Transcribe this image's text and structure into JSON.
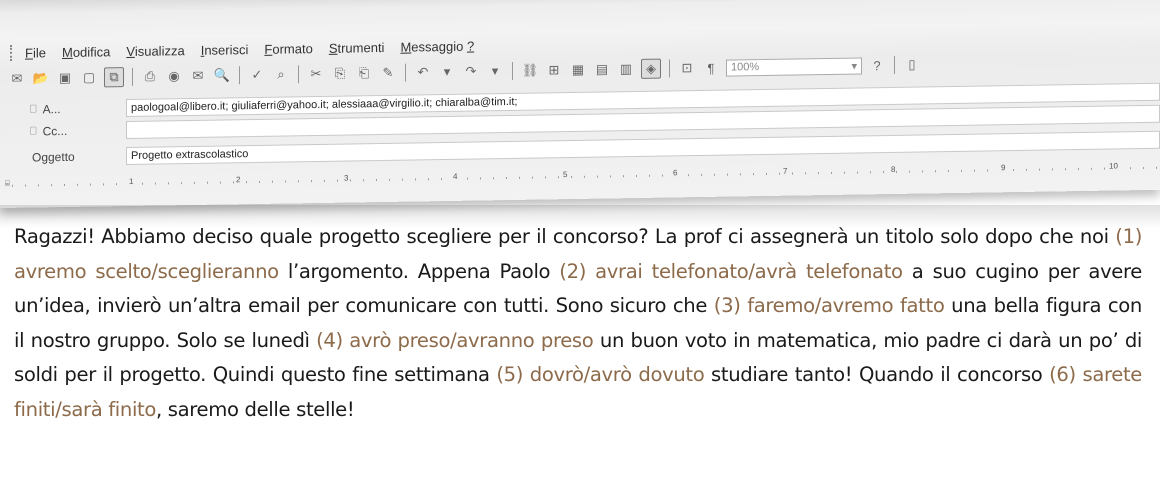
{
  "menu": [
    {
      "u": "F",
      "rest": "ile"
    },
    {
      "u": "M",
      "rest": "odifica"
    },
    {
      "u": "V",
      "rest": "isualizza"
    },
    {
      "u": "I",
      "rest": "nserisci"
    },
    {
      "u": "F",
      "rest": "ormato"
    },
    {
      "u": "S",
      "rest": "trumenti"
    },
    {
      "u": "M",
      "rest": "essaggio"
    },
    {
      "u": "?",
      "rest": ""
    }
  ],
  "toolbar": {
    "zoom_value": "100%"
  },
  "fields": {
    "to_label": "A...",
    "to_value": "paologoal@libero.it; giuliaferri@yahoo.it; alessiaaa@virgilio.it; chiaralba@tim.it;",
    "cc_label": "Cc...",
    "cc_value": "",
    "subject_label": "Oggetto",
    "subject_value": "Progetto extrascolastico"
  },
  "ruler_numbers": [
    "1",
    "2",
    "3",
    "4",
    "5",
    "6",
    "7",
    "8",
    "9",
    "10"
  ],
  "body": {
    "t1": "Ragazzi! Abbiamo deciso quale progetto scegliere per il concorso? La prof ci assegnerà un titolo solo dopo che noi ",
    "o1": "(1) avremo scelto/sceglieranno",
    "t2": " l’argomento. Appena Paolo ",
    "o2": "(2) avrai telefonato/avrà telefonato",
    "t3": " a suo cugino per avere un’idea, invierò un’altra email per comunicare con tutti. Sono sicuro che ",
    "o3": "(3) faremo/avremo fatto",
    "t4": " una bella figura con il nostro gruppo. Solo se lunedì ",
    "o4": "(4) avrò preso/avranno preso",
    "t5": " un buon voto in matematica, mio padre ci darà un po’ di soldi per il progetto. Quindi questo fine settimana ",
    "o5": "(5) dovrò/avrò dovuto",
    "t6": " studiare tanto! Quando il concorso ",
    "o6": "(6) sarete finiti/sarà finito",
    "t7": ", saremo delle stelle!"
  },
  "colors": {
    "option_text": "#8c6a4a"
  }
}
